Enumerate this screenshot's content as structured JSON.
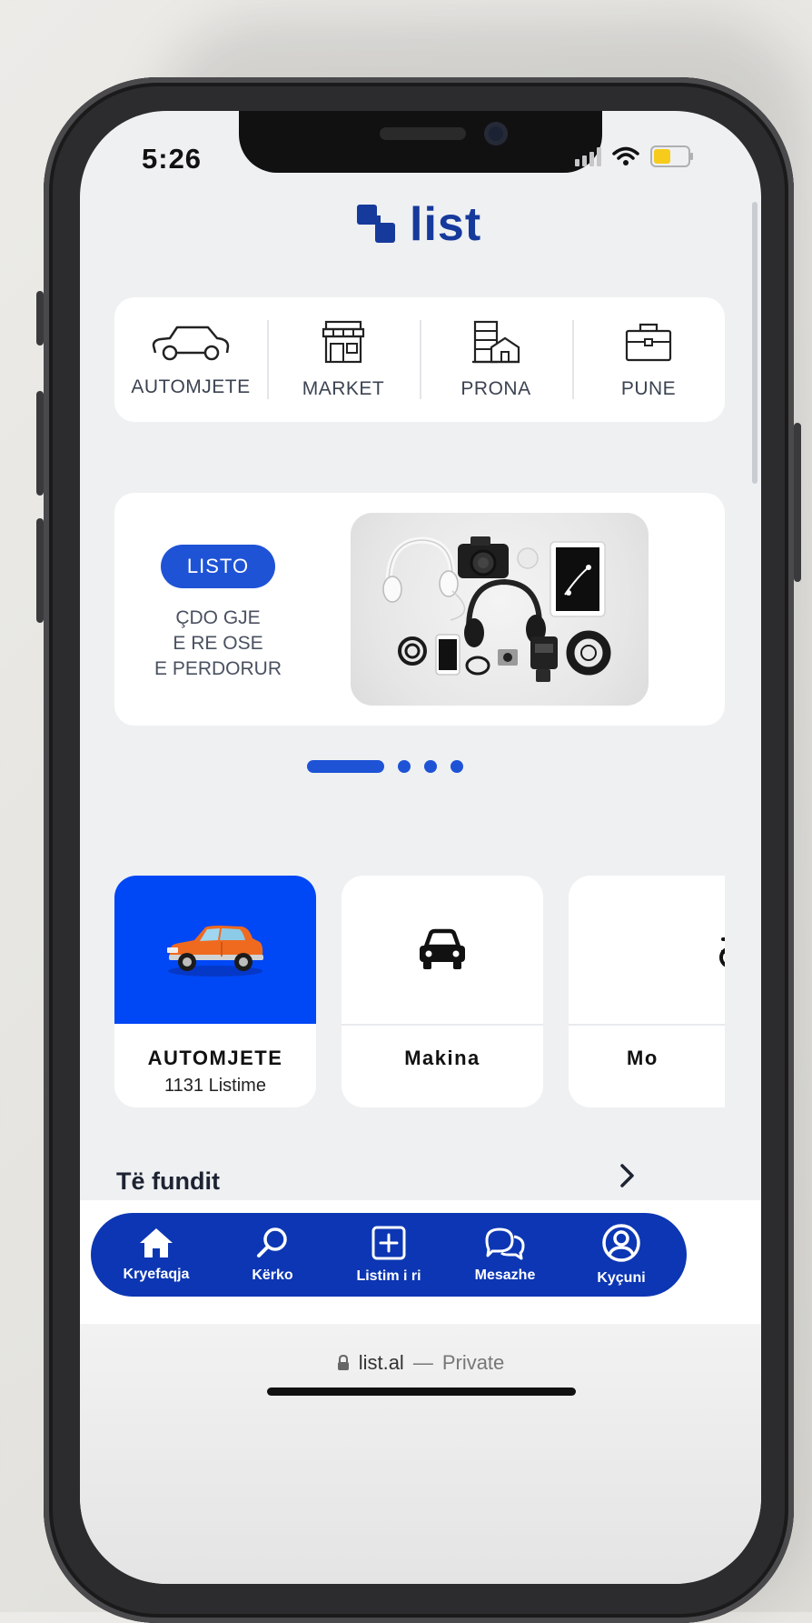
{
  "status_bar": {
    "time": "5:26",
    "battery_color": "#f6cb1b",
    "battery_level": 0.55
  },
  "app": {
    "logo_text": "list",
    "brand_color": "#163a9c",
    "accent_color": "#1e53d6",
    "tabbar_color": "#0c36b3"
  },
  "categories": [
    {
      "label": "AUTOMJETE",
      "icon": "car-outline-icon"
    },
    {
      "label": "MARKET",
      "icon": "store-icon"
    },
    {
      "label": "PRONA",
      "icon": "building-icon"
    },
    {
      "label": "PUNE",
      "icon": "briefcase-icon"
    }
  ],
  "promo": {
    "button_label": "LISTO",
    "line1": "ÇDO GJE",
    "line2": "E RE OSE",
    "line3": "E PERDORUR",
    "image_icon": "electronics-flatlay-image"
  },
  "carousel": {
    "page_count": 4,
    "active_index": 0
  },
  "tiles": [
    {
      "title": "AUTOMJETE",
      "subtitle": "1131 Listime",
      "icon": "orange-vintage-car-image",
      "bg_color": "#0047f5"
    },
    {
      "title": "Makina",
      "icon": "car-front-icon"
    },
    {
      "title": "Mo",
      "icon": "motorcycle-icon"
    }
  ],
  "recent": {
    "title": "Të fundit",
    "icon": "chevron-right-icon"
  },
  "tabbar": [
    {
      "label": "Kryefaqja",
      "icon": "home-icon"
    },
    {
      "label": "Kërko",
      "icon": "search-icon"
    },
    {
      "label": "Listim i ri",
      "icon": "add-square-icon"
    },
    {
      "label": "Mesazhe",
      "icon": "chat-bubbles-icon"
    },
    {
      "label": "Kyçuni",
      "icon": "user-circle-icon"
    }
  ],
  "browser": {
    "domain": "list.al",
    "separator": "—",
    "mode": "Private"
  }
}
